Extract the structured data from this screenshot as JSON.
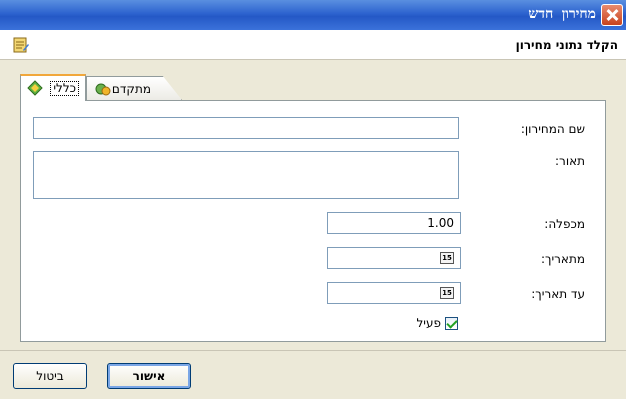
{
  "window": {
    "title": "מחירון חדש"
  },
  "header": {
    "title": "הקלד נתוני מחירון"
  },
  "tabs": [
    {
      "label": "כללי",
      "icon": "general-tab-icon"
    },
    {
      "label": "מתקדם",
      "icon": "advanced-tab-icon"
    }
  ],
  "form": {
    "name_label": "שם המחירון:",
    "name_value": "",
    "description_label": "תאור:",
    "description_value": "",
    "multiplier_label": "מכפלה:",
    "multiplier_value": "1.00",
    "from_date_label": "מתאריך:",
    "from_date_value": "",
    "to_date_label": "עד תאריך:",
    "to_date_value": "",
    "calendar_icon_text": "15",
    "active_label": "פעיל",
    "active_checked": true
  },
  "buttons": {
    "ok_label": "אישור",
    "cancel_label": "ביטול"
  },
  "colors": {
    "titlebar": "#2458c6",
    "accent_tab": "#f1a73b",
    "checkbox_check": "#21a121"
  }
}
